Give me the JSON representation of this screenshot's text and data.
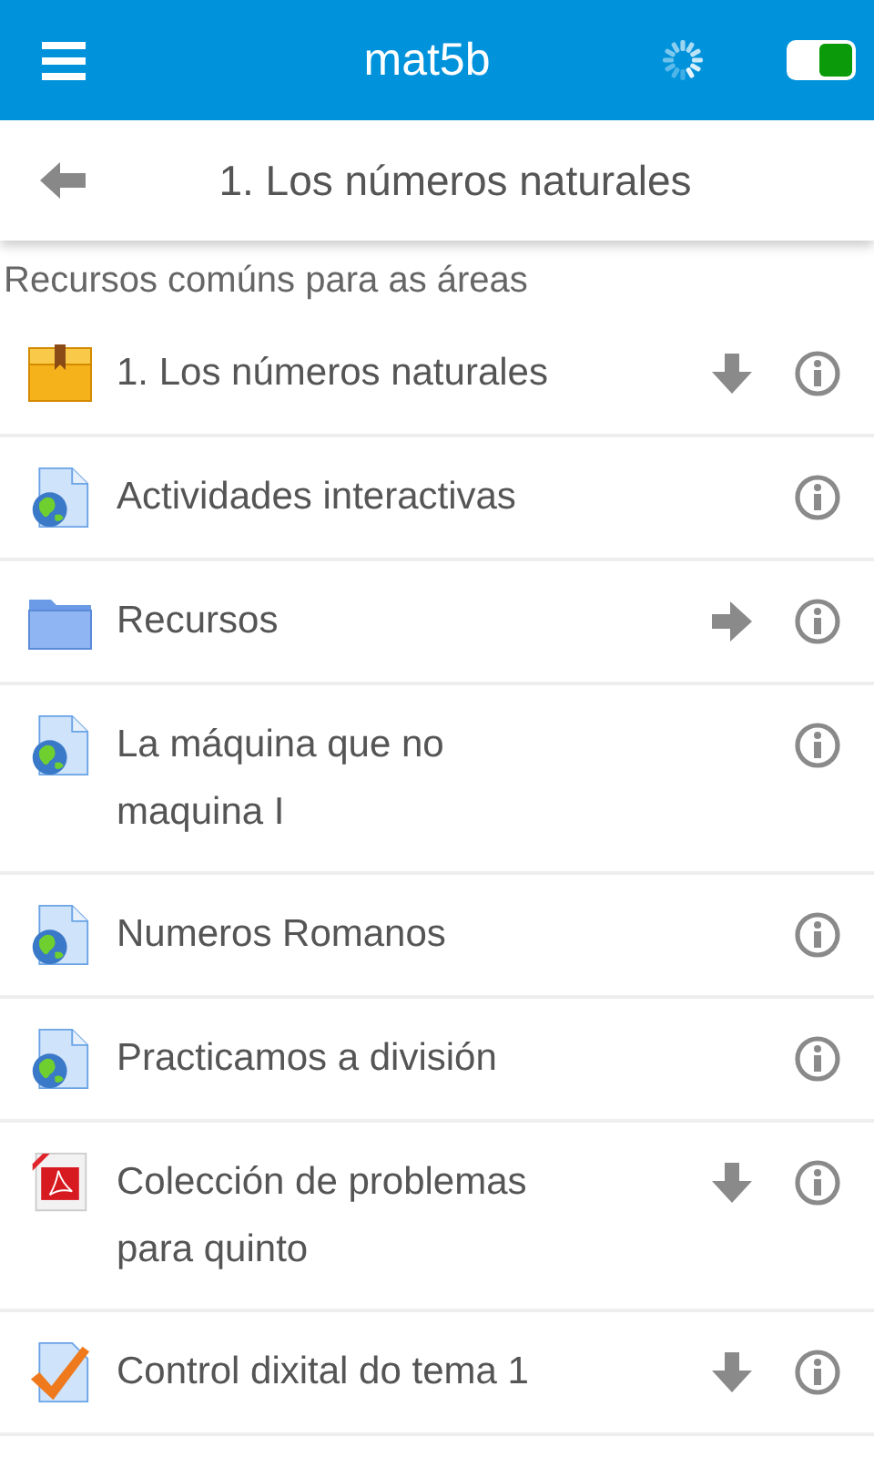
{
  "header": {
    "title": "mat5b",
    "toggle": {
      "on": true
    }
  },
  "subheader": {
    "title": "1. Los números naturales"
  },
  "section": {
    "title": "Recursos comúns para as áreas"
  },
  "items": [
    {
      "kind": "package",
      "label": "1. Los números naturales",
      "downloadable": true,
      "opens": false
    },
    {
      "kind": "web",
      "label": "Actividades interactivas",
      "downloadable": false,
      "opens": false
    },
    {
      "kind": "folder",
      "label": "Recursos",
      "downloadable": false,
      "opens": true
    },
    {
      "kind": "web",
      "label": "La máquina que no maquina I",
      "downloadable": false,
      "opens": false
    },
    {
      "kind": "web",
      "label": "Numeros Romanos",
      "downloadable": false,
      "opens": false
    },
    {
      "kind": "web",
      "label": "Practicamos a división",
      "downloadable": false,
      "opens": false
    },
    {
      "kind": "pdf",
      "label": "Colección de problemas para quinto",
      "downloadable": true,
      "opens": false
    },
    {
      "kind": "quiz",
      "label": "Control dixital do tema 1",
      "downloadable": true,
      "opens": false
    }
  ]
}
